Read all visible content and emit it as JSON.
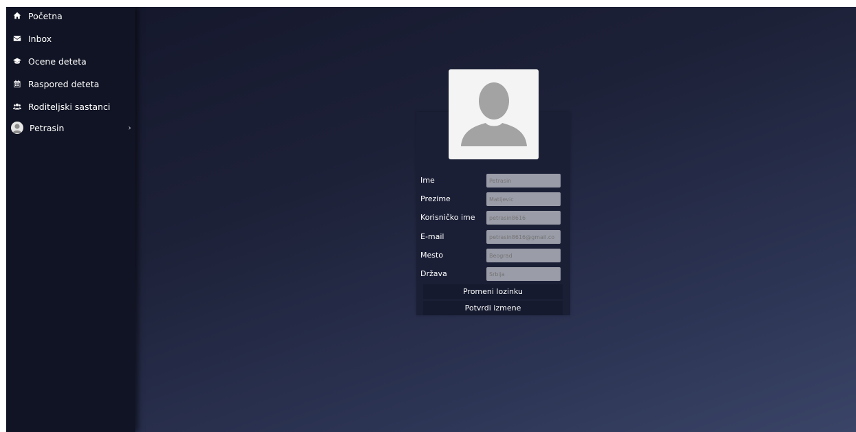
{
  "sidebar": {
    "items": [
      {
        "label": "Početna",
        "icon": "home-icon"
      },
      {
        "label": "Inbox",
        "icon": "envelope-icon"
      },
      {
        "label": "Ocene deteta",
        "icon": "graduation-cap-icon"
      },
      {
        "label": "Raspored deteta",
        "icon": "calendar-icon"
      },
      {
        "label": "Roditeljski sastanci",
        "icon": "users-icon"
      }
    ],
    "user": {
      "label": "Petrasin",
      "chevron": "›"
    }
  },
  "profile": {
    "fields": [
      {
        "label": "Ime",
        "placeholder": "Petrasin"
      },
      {
        "label": "Prezime",
        "placeholder": "Matijevic"
      },
      {
        "label": "Korisničko ime",
        "placeholder": "petrasin8616"
      },
      {
        "label": "E-mail",
        "placeholder": "petrasin8616@gmail.co"
      },
      {
        "label": "Mesto",
        "placeholder": "Beograd"
      },
      {
        "label": "Država",
        "placeholder": "Srbija"
      }
    ],
    "change_password_label": "Promeni lozinku",
    "confirm_label": "Potvrdi izmene"
  },
  "colors": {
    "sidebar_bg": "#111424",
    "card_bg": "#1b1f36",
    "input_bg": "#9a9ca8",
    "button_bg": "#151a2e"
  }
}
